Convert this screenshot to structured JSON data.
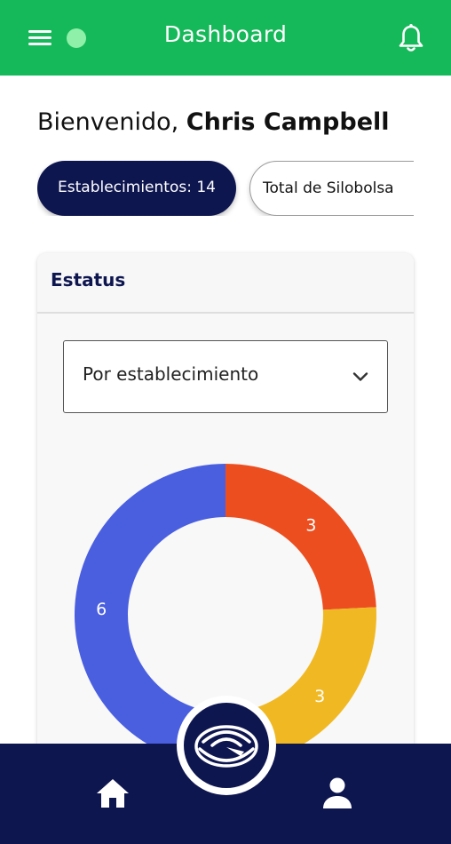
{
  "header": {
    "title": "Dashboard",
    "menu_icon": "menu-icon",
    "status_dot_color": "#8ff0a9",
    "notification_icon": "bell-icon",
    "color": "#16b95a"
  },
  "welcome": {
    "greeting": "Bienvenido,",
    "user_name": "Chris Campbell"
  },
  "chips": [
    {
      "label": "Establecimientos: 14",
      "active": true
    },
    {
      "label": "Total de Silobolsa",
      "active": false
    }
  ],
  "status_card": {
    "title": "Estatus",
    "select": {
      "value": "Por establecimiento",
      "icon": "chevron-down-icon"
    }
  },
  "chart_data": {
    "type": "pie",
    "hole": true,
    "slices": [
      {
        "value": 3,
        "label": "3",
        "color": "#ec4e20"
      },
      {
        "value": 3,
        "label": "3",
        "color": "#f0b924"
      },
      {
        "value": 0.4,
        "label": "",
        "color": "#2ed876"
      },
      {
        "value": 6,
        "label": "6",
        "color": "#4a5fe0"
      }
    ]
  },
  "bottom_nav": {
    "color": "#0e1650",
    "items": [
      {
        "icon": "home-icon"
      },
      {
        "icon": "center-logo-icon"
      },
      {
        "icon": "profile-icon"
      }
    ]
  }
}
